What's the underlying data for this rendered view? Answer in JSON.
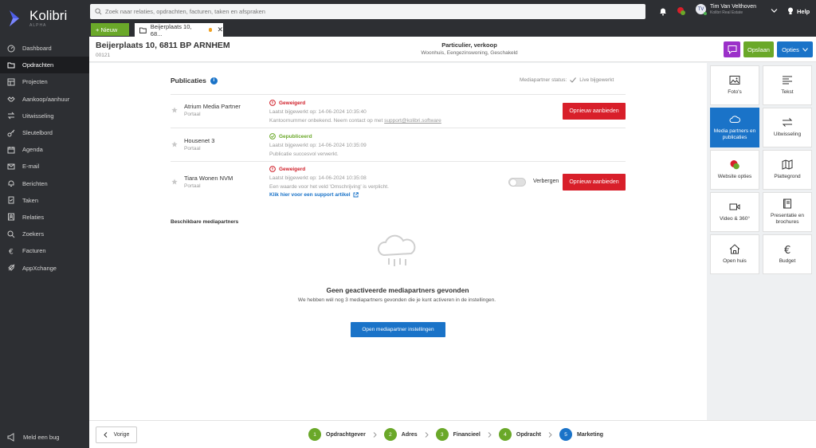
{
  "app": {
    "name": "Kolibri",
    "edition": "ALPHA"
  },
  "sidebar": {
    "items": [
      {
        "label": "Dashboard",
        "icon": "dashboard-icon"
      },
      {
        "label": "Opdrachten",
        "icon": "folder-icon",
        "active": true
      },
      {
        "label": "Projecten",
        "icon": "projects-icon"
      },
      {
        "label": "Aankoop/aanhuur",
        "icon": "handshake-icon"
      },
      {
        "label": "Uitwisseling",
        "icon": "exchange-icon"
      },
      {
        "label": "Sleutelbord",
        "icon": "key-icon"
      },
      {
        "label": "Agenda",
        "icon": "calendar-icon"
      },
      {
        "label": "E-mail",
        "icon": "mail-icon"
      },
      {
        "label": "Berichten",
        "icon": "bell-icon"
      },
      {
        "label": "Taken",
        "icon": "tasks-icon"
      },
      {
        "label": "Relaties",
        "icon": "contacts-icon"
      },
      {
        "label": "Zoekers",
        "icon": "search-icon"
      },
      {
        "label": "Facturen",
        "icon": "euro-icon"
      },
      {
        "label": "AppXchange",
        "icon": "rocket-icon"
      }
    ],
    "bug_label": "Meld een bug"
  },
  "topbar": {
    "search_placeholder": "Zoek naar relaties, opdrachten, facturen, taken en afspraken",
    "user_initials": "TV",
    "user_name": "Tim Van Velthoven",
    "user_org": "Kolibri Real Estate",
    "help_label": "Help"
  },
  "tabs": {
    "new_label": "+ Nieuw",
    "doc_tab_label": "Beijerplaats 10, 68..."
  },
  "header": {
    "title": "Beijerplaats 10, 6811 BP ARNHEM",
    "code": "00121",
    "type": "Particulier, verkoop",
    "subtype": "Woonhuis, Eengezinswoning, Geschakeld",
    "save_label": "Opslaan",
    "options_label": "Opties"
  },
  "publications": {
    "title": "Publicaties",
    "status_label": "Mediapartner status:",
    "status_value": "Live bijgewerkt",
    "rows": [
      {
        "name": "Atrium Media Partner",
        "sub": "Portaal",
        "status": "Geweigerd",
        "updated": "Laatst bijgewerkt op: 14-06-2024 10:35:40",
        "message": "Kantoornummer onbekend. Neem contact op met ",
        "link": "support@kolibri.software",
        "button": "Opnieuw aanbieden"
      },
      {
        "name": "Housenet 3",
        "sub": "Portaal",
        "status": "Gepubliceerd",
        "updated": "Laatst bijgewerkt op: 14-06-2024 10:35:09",
        "message": "Publicatie succesvol verwerkt."
      },
      {
        "name": "Tiara Wonen NVM",
        "sub": "Portaal",
        "status": "Geweigerd",
        "updated": "Laatst bijgewerkt op: 14-06-2024 10:35:08",
        "message": "Een waarde voor het veld 'Omschrijving' is verplicht.",
        "support_link": "Klik hier voor een support artikel",
        "toggle_label": "Verbergen",
        "button": "Opnieuw aanbieden"
      }
    ]
  },
  "available": {
    "title": "Beschikbare mediapartners",
    "empty_title": "Geen geactiveerde mediapartners gevonden",
    "empty_text": "We hebben wél nog 3 mediapartners gevonden die je kunt activeren in de instellingen.",
    "button": "Open mediapartner instellingen"
  },
  "right_panel": {
    "tiles": [
      {
        "label": "Foto's",
        "icon": "photo-icon"
      },
      {
        "label": "Tekst",
        "icon": "text-icon"
      },
      {
        "label": "Media partners en publicaties",
        "icon": "cloud-icon",
        "active": true
      },
      {
        "label": "Uitwisseling",
        "icon": "exchange-icon"
      },
      {
        "label": "Website opties",
        "icon": "website-icon"
      },
      {
        "label": "Plattegrond",
        "icon": "map-icon"
      },
      {
        "label": "Video & 360°",
        "icon": "video-icon"
      },
      {
        "label": "Presentatie en brochures",
        "icon": "book-icon"
      },
      {
        "label": "Open huis",
        "icon": "house-icon"
      },
      {
        "label": "Budget",
        "icon": "euro-icon"
      }
    ]
  },
  "footer": {
    "prev_label": "Vorige",
    "steps": [
      {
        "num": "1",
        "label": "Opdrachtgever"
      },
      {
        "num": "2",
        "label": "Adres"
      },
      {
        "num": "3",
        "label": "Financieel"
      },
      {
        "num": "4",
        "label": "Opdracht"
      },
      {
        "num": "5",
        "label": "Marketing",
        "current": true
      }
    ]
  },
  "colors": {
    "accent_blue": "#1a73c8",
    "accent_green": "#6aa829",
    "danger_red": "#d81f2a",
    "sidebar_bg": "#2d2f33"
  }
}
